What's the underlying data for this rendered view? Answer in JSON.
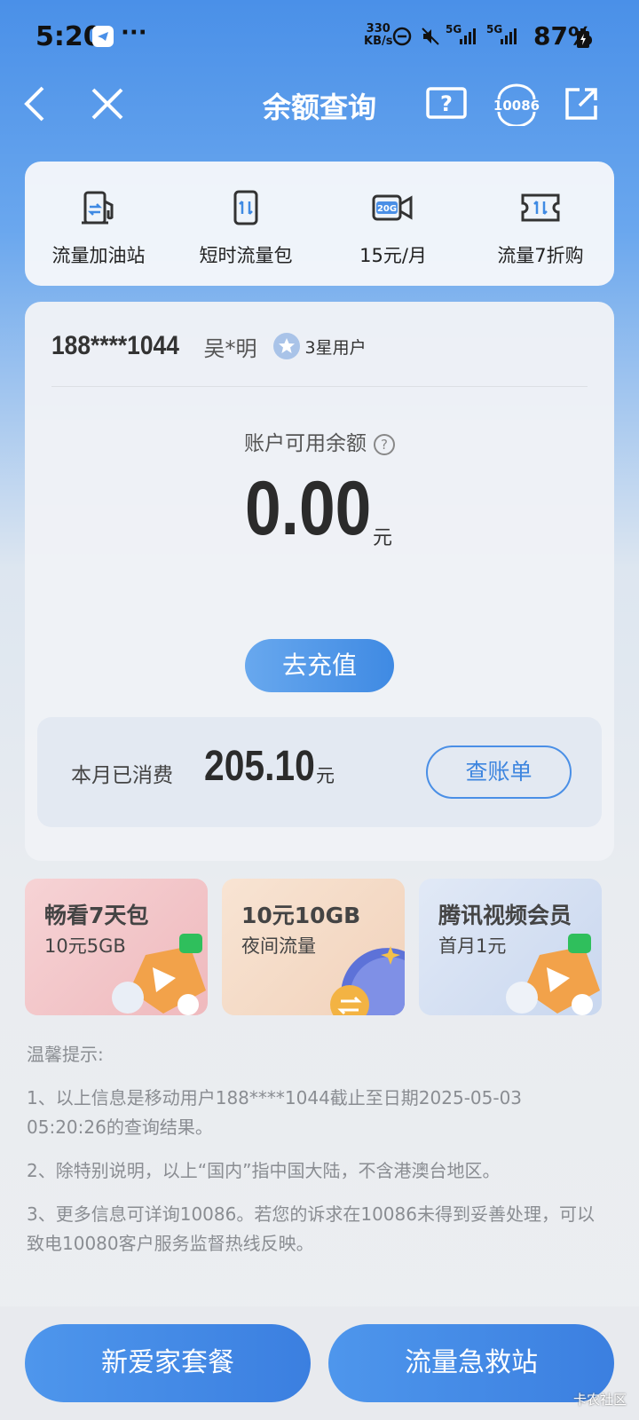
{
  "status_bar": {
    "time": "5:20",
    "more": "···",
    "speed_top": "330",
    "speed_bottom": "KB/s",
    "net1": "5G",
    "net2": "5G",
    "battery": "87%"
  },
  "nav": {
    "title": "余额查询",
    "service_number": "10086"
  },
  "quick_actions": [
    {
      "label": "流量加油站",
      "icon": "fuel-station-icon"
    },
    {
      "label": "短时流量包",
      "icon": "phone-data-icon"
    },
    {
      "label": "15元/月",
      "icon": "video-20g-icon",
      "icon_text": "20G"
    },
    {
      "label": "流量7折购",
      "icon": "ticket-data-icon"
    }
  ],
  "account": {
    "phone": "188****1044",
    "name": "吴*明",
    "level": "3星用户",
    "balance_label": "账户可用余额",
    "balance": "0.00",
    "balance_unit": "元",
    "recharge_label": "去充值",
    "spent_label": "本月已消费",
    "spent_amount": "205.10",
    "spent_unit": "元",
    "bill_label": "查账单"
  },
  "promos": [
    {
      "title": "畅看7天包",
      "sub": "10元5GB",
      "color": "#f3c9cc"
    },
    {
      "title": "10元10GB",
      "sub": "夜间流量",
      "color": "#f4dcc8"
    },
    {
      "title": "腾讯视频会员",
      "sub": "首月1元",
      "color": "#d3dff2"
    }
  ],
  "tips": {
    "heading": "温馨提示:",
    "items": [
      "1、以上信息是移动用户188****1044截止至日期2025-05-03 05:20:26的查询结果。",
      "2、除特别说明，以上“国内”指中国大陆，不含港澳台地区。",
      "3、更多信息可详询10086。若您的诉求在10086未得到妥善处理，可以致电10080客户服务监督热线反映。"
    ]
  },
  "bottom": {
    "left_label": "新爱家套餐",
    "right_label": "流量急救站"
  },
  "watermark": "卡农社区",
  "colors": {
    "accent": "#3f8ae3",
    "header_blue": "#4a90e8"
  }
}
